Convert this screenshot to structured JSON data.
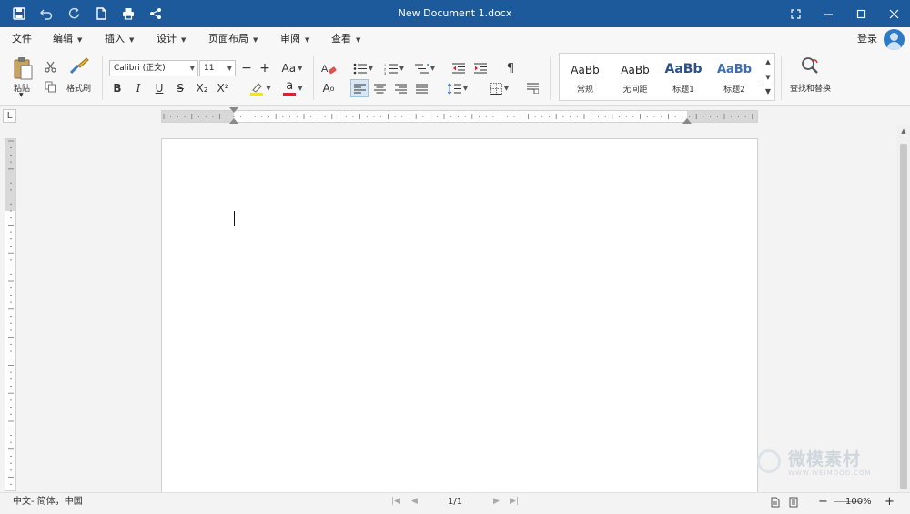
{
  "window": {
    "title": "New Document 1.docx",
    "quick_access_icons": [
      "save-icon",
      "undo-icon",
      "redo-icon",
      "new-document-icon",
      "print-icon",
      "share-icon"
    ],
    "controls": [
      "fullscreen-icon",
      "minimize-icon",
      "maximize-icon",
      "close-icon"
    ]
  },
  "menu": {
    "items": [
      {
        "label": "文件",
        "dropdown": false
      },
      {
        "label": "编辑",
        "dropdown": true
      },
      {
        "label": "插入",
        "dropdown": true
      },
      {
        "label": "设计",
        "dropdown": true
      },
      {
        "label": "页面布局",
        "dropdown": true
      },
      {
        "label": "审阅",
        "dropdown": true
      },
      {
        "label": "查看",
        "dropdown": true
      }
    ],
    "login_label": "登录"
  },
  "ribbon": {
    "clipboard": {
      "paste_label": "粘贴",
      "format_painter_label": "格式刷"
    },
    "font": {
      "name": "Calibri (正文)",
      "size": "11",
      "case_label": "Aa",
      "bold": "B",
      "italic": "I",
      "underline": "U",
      "strikethrough": "S",
      "subscript": "X₂",
      "superscript": "X²",
      "font_color_glyph": "a",
      "font_color": "#d7262b",
      "highlight_color": "#f2e12f",
      "char_style_label": "A"
    },
    "paragraph": {
      "marks_glyph": "¶"
    },
    "styles": [
      {
        "sample": "AaBb",
        "name": "常规",
        "bold": false
      },
      {
        "sample": "AaBb",
        "name": "无间距",
        "bold": false
      },
      {
        "sample": "AaBb",
        "name": "标题1",
        "bold": true
      },
      {
        "sample": "AaBb",
        "name": "标题2",
        "bold": true
      }
    ],
    "find_replace_label": "查找和替换"
  },
  "ruler": {
    "corner_glyph": "L"
  },
  "status": {
    "language": "中文- 简体，中国",
    "page": "1/1",
    "zoom": "100%",
    "zoom_out": "−",
    "zoom_in": "+"
  },
  "watermark": {
    "text": "微模素材",
    "subtext": "WWW.WEIMOOO.COM"
  },
  "colors": {
    "titlebar": "#1c5a9b",
    "accent": "#2d7ac5",
    "heading_style": "#2b4f8a"
  }
}
